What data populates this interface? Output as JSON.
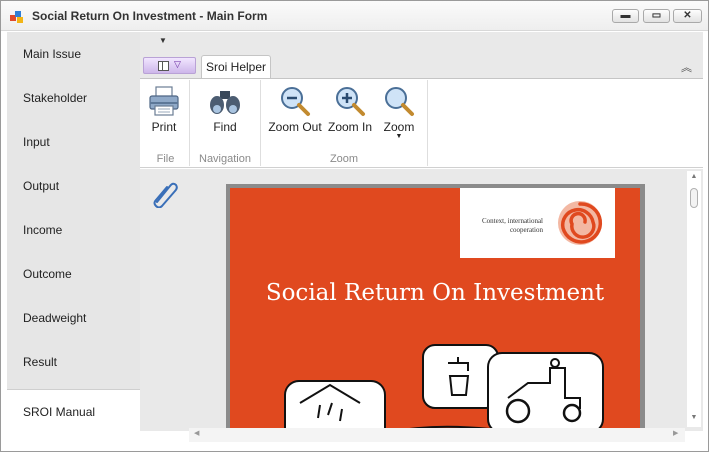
{
  "window": {
    "title": "Social Return On Investment - Main Form",
    "controls": {
      "minimize": "▬",
      "maximize": "▭",
      "close": "✕"
    }
  },
  "nav": {
    "items": [
      {
        "label": "Main Issue"
      },
      {
        "label": "Stakeholder"
      },
      {
        "label": "Input"
      },
      {
        "label": "Output"
      },
      {
        "label": "Income"
      },
      {
        "label": "Outcome"
      },
      {
        "label": "Deadweight"
      },
      {
        "label": "Result"
      },
      {
        "label": "SROI Manual",
        "active": true
      }
    ]
  },
  "ribbon": {
    "tab": "Sroi Helper",
    "groups": {
      "file": {
        "label": "File",
        "buttons": [
          {
            "label": "Print",
            "icon": "printer-icon"
          }
        ]
      },
      "navigation": {
        "label": "Navigation",
        "buttons": [
          {
            "label": "Find",
            "icon": "binoculars-icon"
          }
        ]
      },
      "zoom": {
        "label": "Zoom",
        "buttons": [
          {
            "label": "Zoom Out",
            "icon": "zoom-out-icon"
          },
          {
            "label": "Zoom In",
            "icon": "zoom-in-icon"
          },
          {
            "label": "Zoom",
            "icon": "zoom-icon",
            "dropdown": "▼"
          }
        ]
      }
    }
  },
  "document": {
    "logo_text": "Context, international cooperation",
    "cover_title": "Social Return On Investment",
    "cover_color": "#e0491f"
  },
  "colors": {
    "accent": "#e0491f",
    "nav_background": "#e6e6e6",
    "app_button": "#cdb6ea"
  }
}
